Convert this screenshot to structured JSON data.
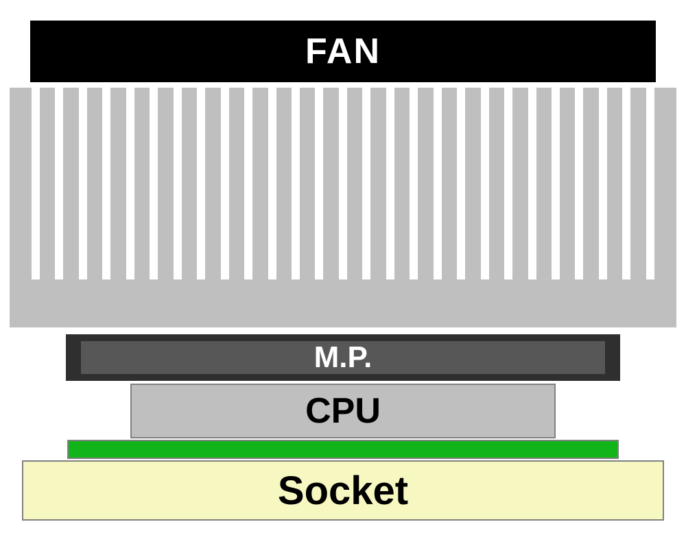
{
  "diagram": {
    "fan_label": "FAN",
    "mp_label": "M.P.",
    "cpu_label": "CPU",
    "socket_label": "Socket",
    "heatsink_fin_gaps": 27
  }
}
